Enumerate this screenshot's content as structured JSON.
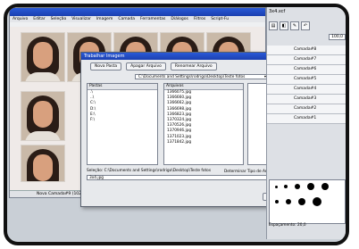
{
  "app": {
    "menu": [
      "Arquivo",
      "Editar",
      "Seleção",
      "Visualizar",
      "Imagem",
      "Camada",
      "Ferramentas",
      "Diálogos",
      "Filtros",
      "Script-Fu"
    ],
    "status": "Nova Camada#9 (102"
  },
  "dialog": {
    "title": "Trabalhar Imagem",
    "buttons": [
      "Nova Pasta",
      "Apagar Arquivo",
      "Renomear Arquivo"
    ],
    "path": "C:\\Documents and Settings\\rodrigo\\Desktop\\Teste fotos",
    "folders_header": "Pastas",
    "folders": [
      ".\\",
      "..\\",
      "C:\\",
      "D:\\",
      "E:\\",
      "F:\\"
    ],
    "files_header": "Arquivos",
    "files": [
      "1366075.jpg",
      "1366660.jpg",
      "1366662.jpg",
      "1366698.jpg",
      "1366823.jpg",
      "1370324.jpg",
      "1370526.jpg",
      "1370946.jpg",
      "1371023.jpg",
      "1371842.jpg"
    ],
    "preview_text": "Nenhuma seleção",
    "selection_label": "Seleção: C:\\Documents and Settings\\rodrigo\\Desktop\\Teste fotos",
    "filetype_label": "Determinar Tipo de Arquivo:",
    "filetype_value": "Por Extensão",
    "filename": "3x4.jpg",
    "cancel": "Cancelar",
    "ok": "OK"
  },
  "panel": {
    "layer_file": "3x4.xcf",
    "opacity": "100,0",
    "layers": [
      "Camada#8",
      "Camada#7",
      "Camada#6",
      "Camada#5",
      "Camada#4",
      "Camada#3",
      "Camada#2",
      "Camada#1"
    ],
    "spacing_label": "Espaçamento:",
    "spacing_value": "20,0"
  }
}
